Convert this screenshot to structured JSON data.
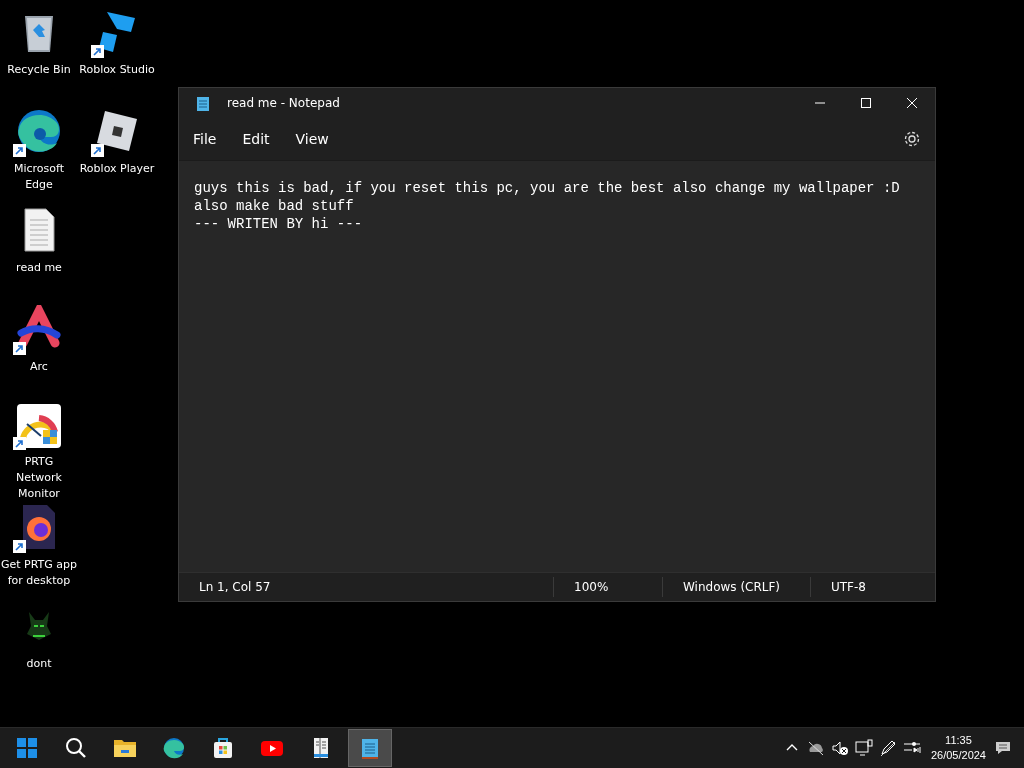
{
  "desktop_icons": [
    {
      "label": "Recycle Bin",
      "shortcut": false
    },
    {
      "label": "Microsoft Edge",
      "shortcut": true
    },
    {
      "label": "read me",
      "shortcut": false
    },
    {
      "label": "Arc",
      "shortcut": true
    },
    {
      "label": "PRTG Network Monitor",
      "shortcut": true
    },
    {
      "label": "Get PRTG app for desktop",
      "shortcut": true
    },
    {
      "label": "dont",
      "shortcut": false
    },
    {
      "label": "Roblox Studio",
      "shortcut": true
    },
    {
      "label": "Roblox Player",
      "shortcut": true
    }
  ],
  "window": {
    "title": "read me - Notepad",
    "menu": [
      "File",
      "Edit",
      "View"
    ],
    "text_lines": [
      "guys this is bad, if you reset this pc, you are the best also change my wallpaper :D",
      "also make bad stuff",
      "--- WRITEN BY hi ---"
    ],
    "status_bar": [
      "Ln 1, Col 57",
      "100%",
      "Windows (CRLF)",
      "UTF-8"
    ]
  },
  "taskbar": {
    "apps": [
      {
        "selected": false
      },
      {
        "selected": false
      },
      {
        "selected": false
      },
      {
        "selected": false
      },
      {
        "selected": false
      },
      {
        "selected": false
      },
      {
        "selected": false
      },
      {
        "selected": true
      }
    ],
    "time": "11:35",
    "date": "26/05/2024"
  }
}
